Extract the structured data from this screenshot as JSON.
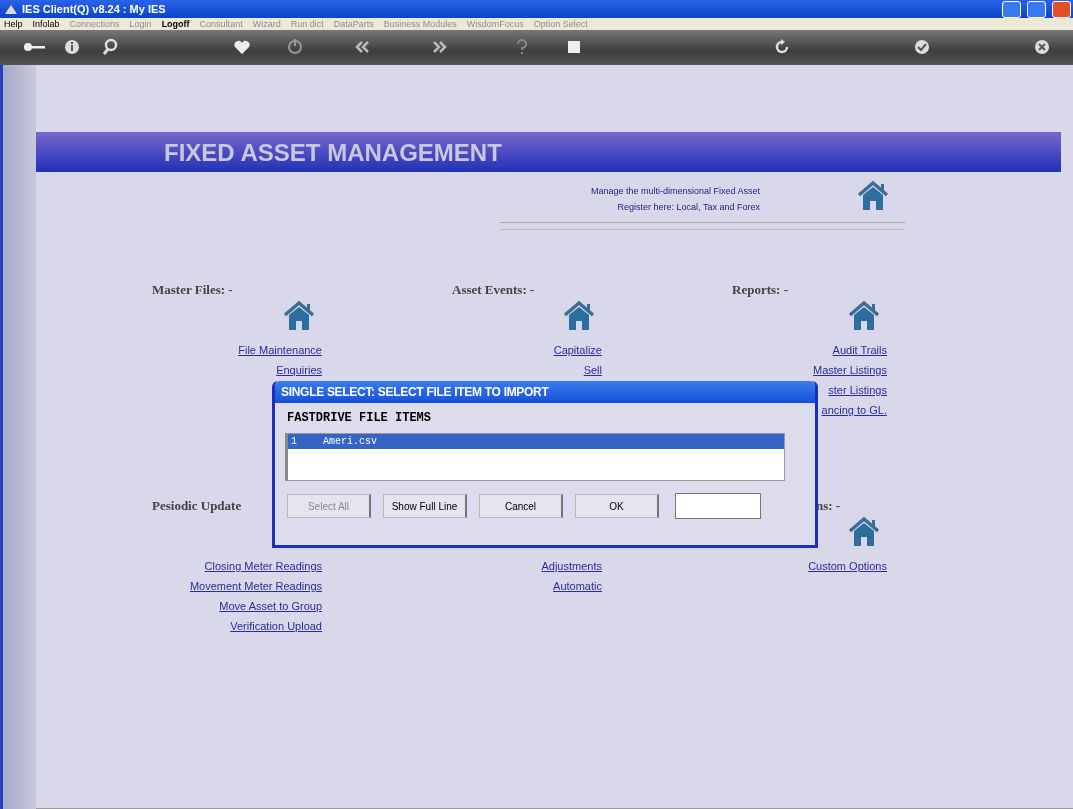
{
  "window": {
    "title": "IES Client(Q) v8.24 : My IES"
  },
  "menu": [
    {
      "label": "Help",
      "disabled": false
    },
    {
      "label": "Infolab",
      "disabled": false
    },
    {
      "label": "Connections",
      "disabled": true
    },
    {
      "label": "Login",
      "disabled": true
    },
    {
      "label": "Logoff",
      "disabled": false
    },
    {
      "label": "Consultant",
      "disabled": true
    },
    {
      "label": "Wizard",
      "disabled": true
    },
    {
      "label": "Run dict",
      "disabled": true
    },
    {
      "label": "DataParts",
      "disabled": true
    },
    {
      "label": "Business Modules",
      "disabled": true
    },
    {
      "label": "WisdomFocus",
      "disabled": true
    },
    {
      "label": "Option Select",
      "disabled": true
    }
  ],
  "toolbar": [
    {
      "kind": "key"
    },
    {
      "kind": "info"
    },
    {
      "kind": "search"
    },
    {
      "kind": "heart"
    },
    {
      "kind": "power"
    },
    {
      "kind": "back"
    },
    {
      "kind": "forward"
    },
    {
      "kind": "help"
    },
    {
      "kind": "stop"
    },
    {
      "kind": "refresh"
    },
    {
      "kind": "check"
    },
    {
      "kind": "close"
    }
  ],
  "page": {
    "title": "FIXED ASSET MANAGEMENT",
    "intro": [
      "Manage the multi-dimensional Fixed Asset",
      "Register here: Local, Tax and Forex"
    ]
  },
  "section_rows": [
    [
      {
        "kind": "icon",
        "heading": "Master Files: -",
        "links": [
          "File Maintenance",
          "Enquiries"
        ]
      },
      {
        "kind": "icon",
        "heading": "Asset Events: -",
        "links": [
          "Capitalize",
          "Sell"
        ]
      },
      {
        "kind": "icon",
        "heading": "Reports: -",
        "links": [
          "Audit Trails",
          "Master Listings",
          "ster Listings",
          "ancing to GL."
        ]
      }
    ],
    [
      {
        "kind": "plain",
        "heading": "Pesiodic Update",
        "links": [
          "Closing Meter Readings",
          "Movement Meter Readings",
          "Move Asset to Group",
          "Verification Upload"
        ]
      },
      {
        "kind": "plain",
        "links": [
          "Adjustments",
          "Automatic"
        ]
      },
      {
        "kind": "icon",
        "heading": "ns: -",
        "links": [
          "Custom Options"
        ]
      }
    ]
  ],
  "dialog": {
    "title": "SINGLE SELECT: SELECT FILE ITEM TO IMPORT",
    "label": "FASTDRIVE FILE ITEMS",
    "items": [
      {
        "number": "1",
        "name": "Ameri.csv",
        "selected": true
      }
    ],
    "buttons": [
      {
        "label": "Select All",
        "disabled": true
      },
      {
        "label": "Show Full Line",
        "disabled": false
      },
      {
        "label": "Cancel",
        "disabled": false
      },
      {
        "label": "OK",
        "disabled": false
      }
    ]
  }
}
